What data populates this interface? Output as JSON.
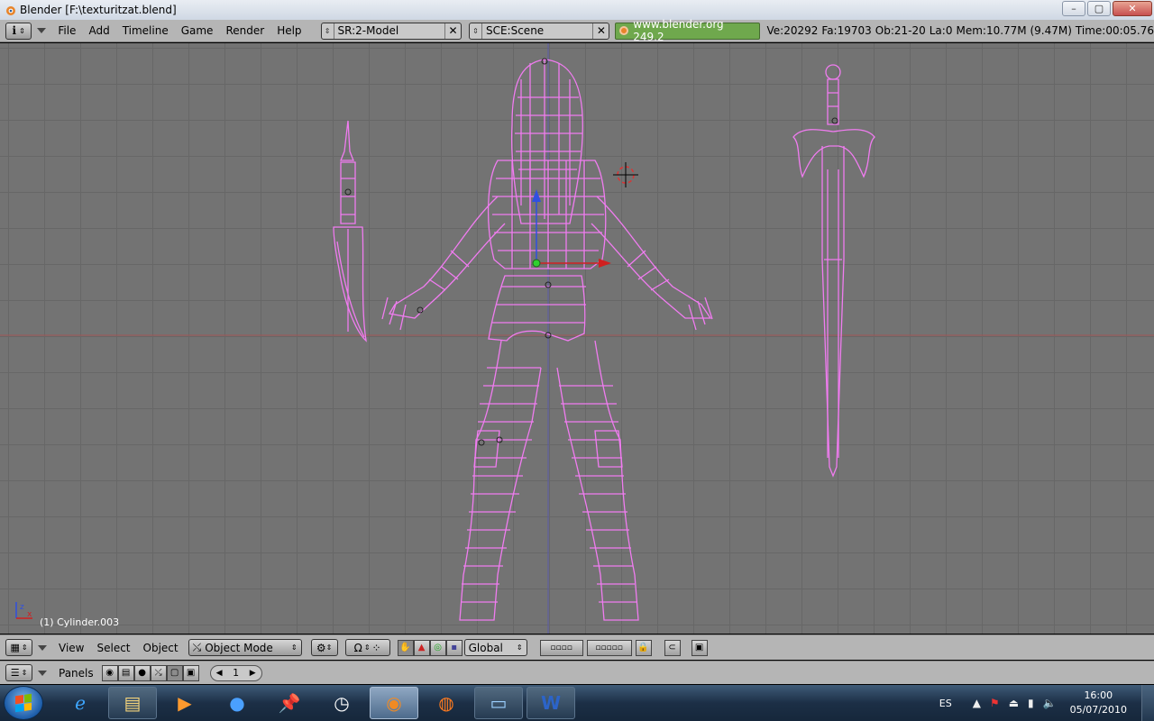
{
  "window": {
    "title": "Blender [F:\\texturitzat.blend]",
    "buttons": {
      "minimize": "–",
      "maximize": "▢",
      "close": "✕"
    }
  },
  "topbar": {
    "menus": [
      "File",
      "Add",
      "Timeline",
      "Game",
      "Render",
      "Help"
    ],
    "screen": "SR:2-Model",
    "scene": "SCE:Scene",
    "url": "www.blender.org 249.2",
    "stats": {
      "verts": "Ve:20292",
      "faces": "Fa:19703",
      "objects": "Ob:21-20",
      "lamps": "La:0",
      "memory": "Mem:10.77M (9.47M)",
      "time": "Time:00:05.76"
    }
  },
  "viewport": {
    "object_label": "(1) Cylinder.003",
    "wire_color": "#f07cf0",
    "bg_color": "#737373"
  },
  "viewbar": {
    "menus": [
      "View",
      "Select",
      "Object"
    ],
    "mode": "Object Mode",
    "orientation": "Global"
  },
  "panelbar": {
    "label": "Panels",
    "frame": "1"
  },
  "taskbar": {
    "items": [
      "internet-explorer",
      "file-explorer",
      "media-player",
      "user-app",
      "pin-app",
      "clock-app",
      "blender",
      "firefox",
      "photo-viewer",
      "word"
    ],
    "tray": {
      "lang": "ES",
      "time": "16:00",
      "date": "05/07/2010"
    }
  }
}
